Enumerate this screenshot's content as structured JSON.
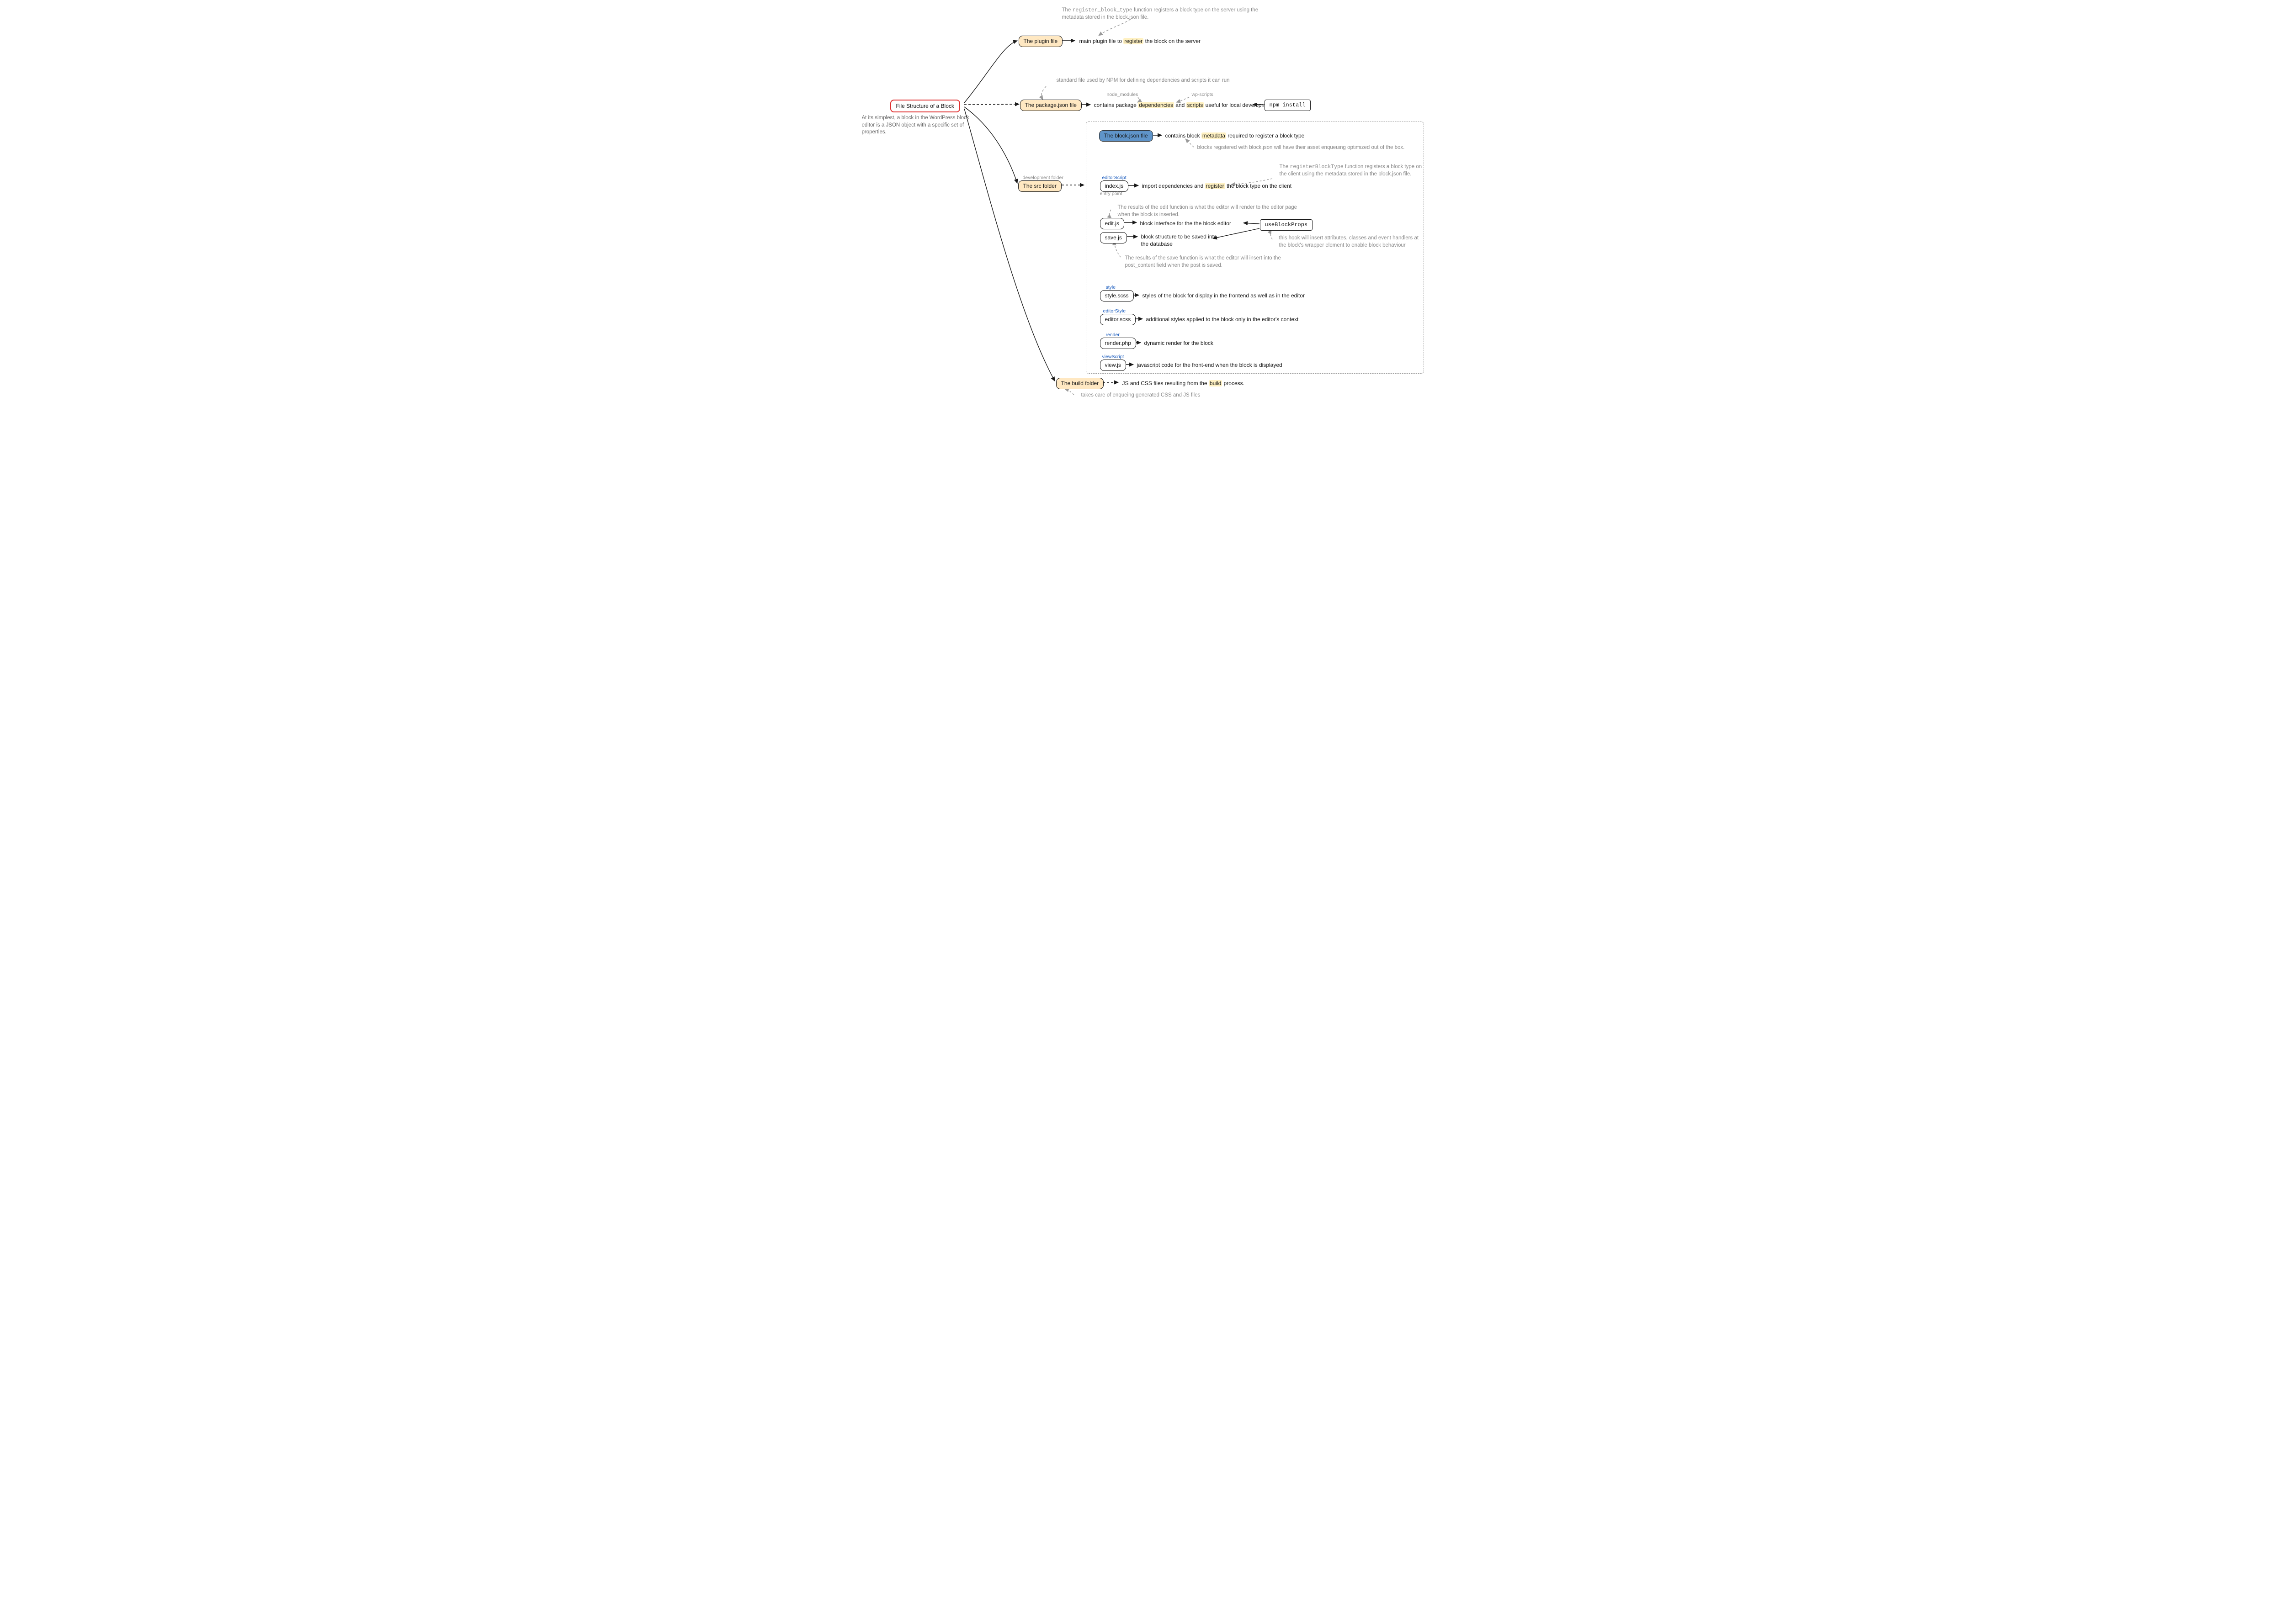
{
  "root": {
    "title": "File Structure of a Block",
    "subtitle": "At its simplest, a block in the WordPress block editor is a JSON object with a specific set of properties."
  },
  "plugin_file": {
    "label": "The plugin file",
    "desc_a": "main plugin file to ",
    "desc_hl": "register",
    "desc_b": " the block on the server",
    "note_a": "The ",
    "note_code": "register_block_type",
    "note_b": " function registers a block type on the server using the metadata stored in the block.json file."
  },
  "package_json": {
    "label": "The package.json file",
    "desc_a": "contains package ",
    "desc_hl1": "dependencies",
    "desc_mid": " and ",
    "desc_hl2": "scripts",
    "desc_b": " useful for local development",
    "top_note": "standard file used by NPM for defining dependencies and scripts it can run",
    "tag_node_modules": "node_modules",
    "tag_wp_scripts": "wp-scripts",
    "npm_install": "npm install"
  },
  "src_folder": {
    "label": "The src folder",
    "top_tag": "development folder",
    "block_json": {
      "label": "The block.json file",
      "desc_a": "contains block ",
      "desc_hl": "metadata",
      "desc_b": " required to register a block type",
      "note_below": "blocks registered with block.json will have their asset enqueuing optimized out of the box.",
      "client_note_a": "The ",
      "client_note_code": "registerBlockType",
      "client_note_b": " function registers a block type on the client using the metadata stored in the block.json file."
    },
    "index_js": {
      "tag": "editorScript",
      "label": "index.js",
      "desc_a": "import dependencies and ",
      "desc_hl": "register",
      "desc_b": " the block type on the client",
      "entry": "entry point"
    },
    "edit_js": {
      "label": "edit.js",
      "desc": "block interface for the the block editor",
      "note": "The results of the edit function is what the editor will render to the editor page when the block is inserted."
    },
    "save_js": {
      "label": "save.js",
      "desc": "block structure to be saved into the database",
      "note": "The results of the save function is what the editor will insert into the post_content field when the post is saved."
    },
    "useBlockProps": {
      "label": "useBlockProps",
      "note": "this hook will insert attributes, classes and event handlers at the block's wrapper element to enable block behaviour"
    },
    "style_scss": {
      "tag": "style",
      "label": "style.scss",
      "desc": "styles of the block for display in the frontend as well as in the editor"
    },
    "editor_scss": {
      "tag": "editorStyle",
      "label": "editor.scss",
      "desc": "additional styles applied to the block only in the editor's context"
    },
    "render_php": {
      "tag": "render",
      "label": "render.php",
      "desc": "dynamic render for the block"
    },
    "view_js": {
      "tag": "viewScript",
      "label": "view.js",
      "desc": "javascript code for the front-end when the block is displayed"
    }
  },
  "build_folder": {
    "label": "The build folder",
    "desc_a": "JS and CSS files resulting from the ",
    "desc_hl": "build",
    "desc_b": " process.",
    "note": "takes care of enqueing generated CSS and JS files"
  }
}
